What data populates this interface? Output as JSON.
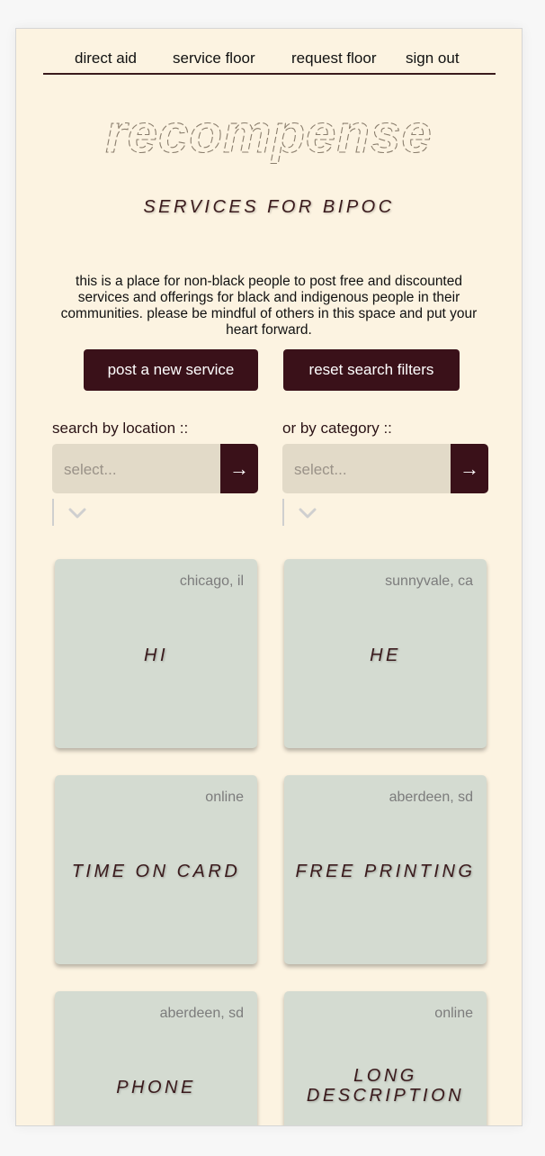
{
  "nav": {
    "items": [
      {
        "label": "direct aid"
      },
      {
        "label": "service floor"
      },
      {
        "label": "request floor"
      },
      {
        "label": "sign out"
      }
    ]
  },
  "logo": {
    "text": "recompense"
  },
  "tagline": "SERVICES FOR BIPOC",
  "intro": "this is a place for non-black people to post free and discounted services and offerings for black and indigenous people in their communities. please be mindful of others in this space and put your heart forward.",
  "actions": {
    "post_label": "post a new service",
    "reset_label": "reset search filters"
  },
  "filters": {
    "location": {
      "label": "search by location ::",
      "placeholder": "select...",
      "go": "→"
    },
    "category": {
      "label": "or by category ::",
      "placeholder": "select...",
      "go": "→"
    }
  },
  "cards": [
    {
      "location": "chicago, il",
      "title": "HI"
    },
    {
      "location": "sunnyvale, ca",
      "title": "HE"
    },
    {
      "location": "online",
      "title": "TIME ON CARD"
    },
    {
      "location": "aberdeen, sd",
      "title": "FREE PRINTING"
    },
    {
      "location": "aberdeen, sd",
      "title": "PHONE"
    },
    {
      "location": "online",
      "title_line1": "LONG",
      "title_line2": "DESCRIPTION"
    }
  ],
  "colors": {
    "background": "#fcf3e1",
    "accent": "#3a1119",
    "card": "#d4dbd1",
    "select_bg": "#e2dac8"
  }
}
